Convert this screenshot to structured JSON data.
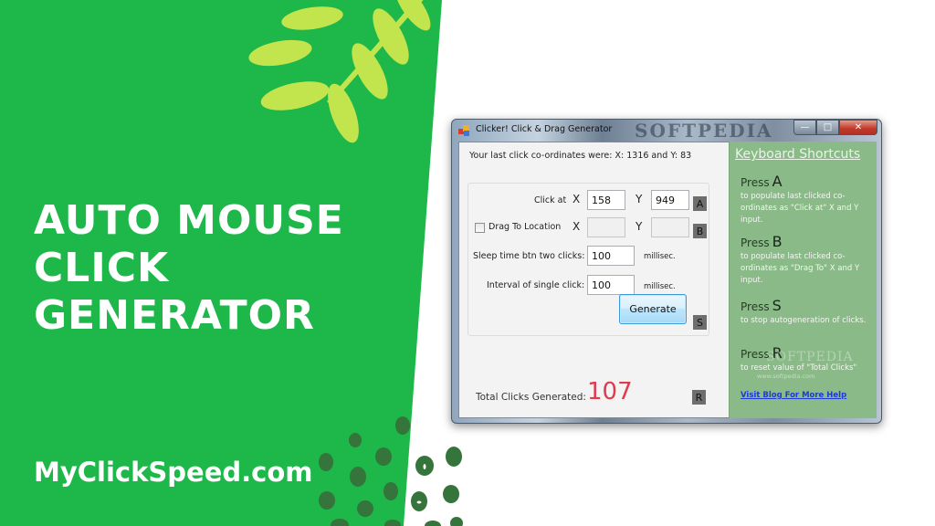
{
  "banner": {
    "headline_lines": [
      "AUTO MOUSE",
      "CLICK",
      "GENERATOR"
    ],
    "site": "MyClickSpeed.com",
    "colors": {
      "green": "#1eb84a",
      "leaf": "#c2e54e",
      "dots": "#35743a"
    }
  },
  "window": {
    "title": "Clicker! Click & Drag Generator",
    "title_watermark": "SOFTPEDIA",
    "controls": {
      "minimize": "—",
      "maximize": "□",
      "close": "✕"
    },
    "last_click_text": "Your last click co-ordinates were: X: 1316 and Y: 83",
    "form": {
      "click_at_label": "Click at",
      "x_label": "X",
      "y_label": "Y",
      "click_at_x": "158",
      "click_at_y": "949",
      "drag_label": "Drag To Location",
      "drag_checked": false,
      "drag_x": "",
      "drag_y": "",
      "sleep_label": "Sleep time btn two clicks:",
      "sleep_value": "100",
      "interval_label": "Interval of single click:",
      "interval_value": "100",
      "unit": "millisec.",
      "generate_label": "Generate",
      "badges": {
        "a": "A",
        "b": "B",
        "s": "S",
        "r": "R"
      }
    },
    "total_label": "Total Clicks Generated:",
    "total_value": "107",
    "shortcuts": {
      "title": "Keyboard Shortcuts",
      "press_word": "Press",
      "items": [
        {
          "key": "A",
          "desc": "to populate last clicked co-ordinates as \"Click at\" X and Y input."
        },
        {
          "key": "B",
          "desc": "to populate last clicked co-ordinates as \"Drag To\" X and Y input."
        },
        {
          "key": "S",
          "desc": "to stop autogeneration of clicks."
        },
        {
          "key": "R",
          "desc": "to reset value of \"Total Clicks\""
        }
      ],
      "link": "Visit Blog For More Help",
      "watermark": "SOFTPEDIA",
      "watermark_url": "www.softpedia.com"
    }
  }
}
